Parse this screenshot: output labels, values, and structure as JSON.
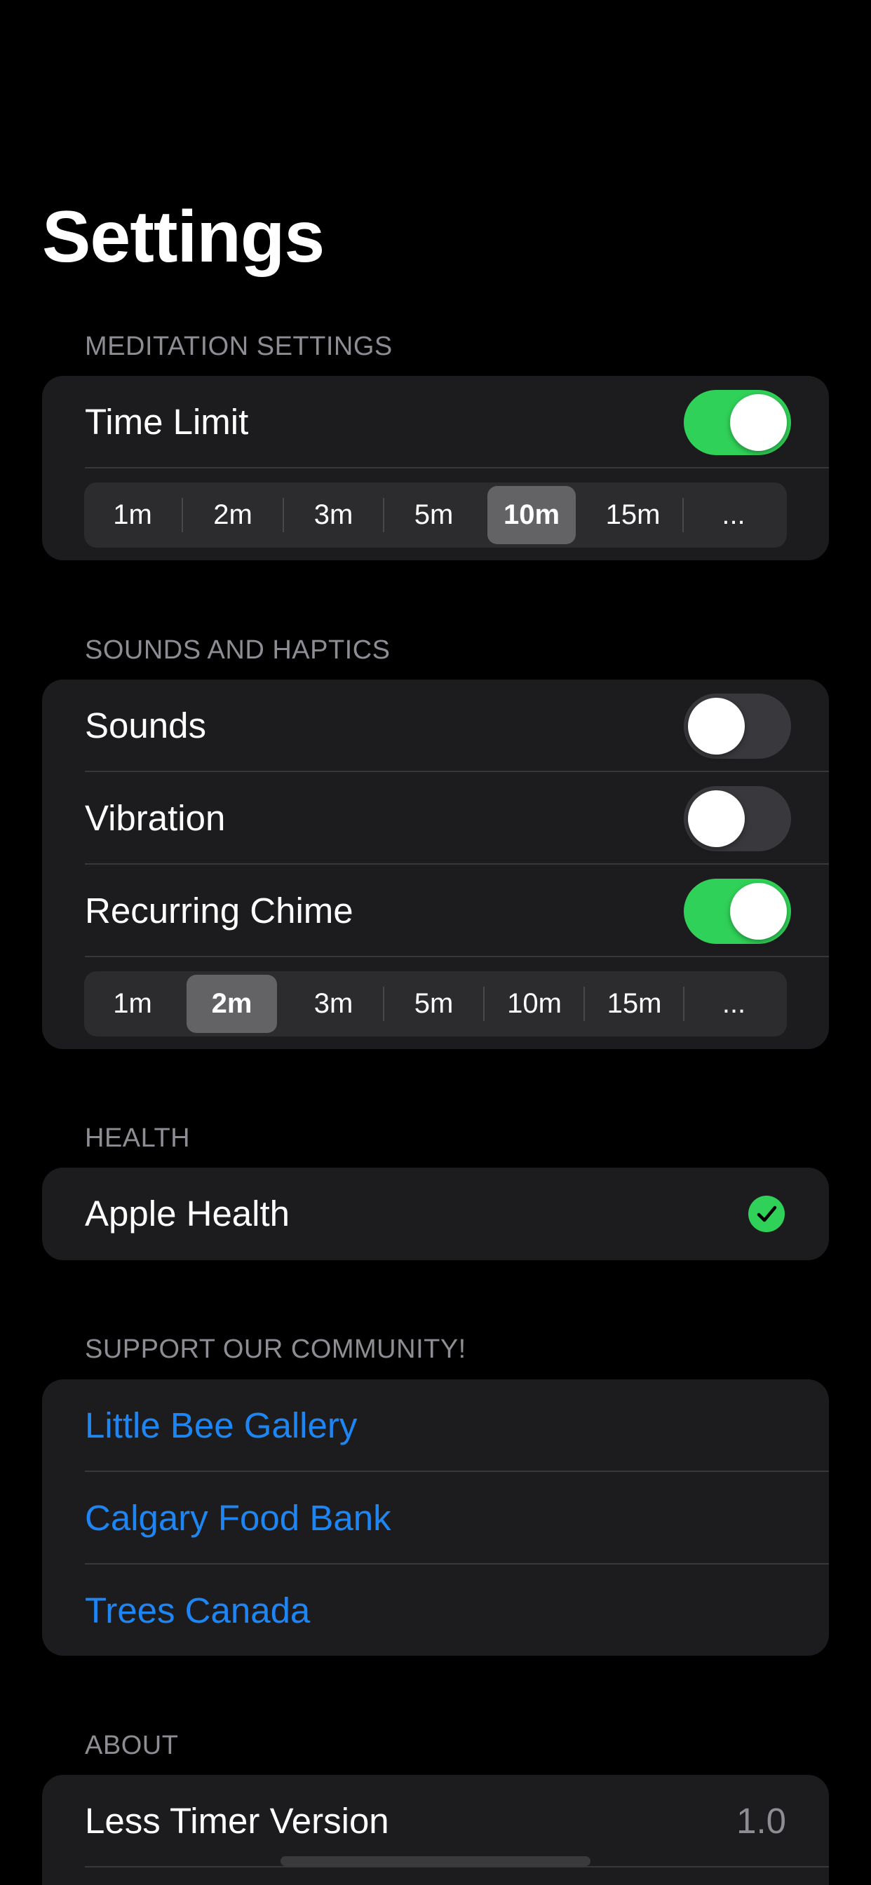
{
  "page": {
    "title": "Settings"
  },
  "meditation": {
    "header": "MEDITATION SETTINGS",
    "time_limit": {
      "label": "Time Limit",
      "enabled": true
    },
    "durations": [
      "1m",
      "2m",
      "3m",
      "5m",
      "10m",
      "15m",
      "..."
    ],
    "selected": "10m"
  },
  "sounds": {
    "header": "SOUNDS AND HAPTICS",
    "sounds": {
      "label": "Sounds",
      "enabled": false
    },
    "vibration": {
      "label": "Vibration",
      "enabled": false
    },
    "chime": {
      "label": "Recurring Chime",
      "enabled": true
    },
    "durations": [
      "1m",
      "2m",
      "3m",
      "5m",
      "10m",
      "15m",
      "..."
    ],
    "selected": "2m"
  },
  "health": {
    "header": "HEALTH",
    "apple_health": {
      "label": "Apple Health",
      "checked": true,
      "icon": "checkmark-circle-icon"
    }
  },
  "community": {
    "header": "SUPPORT OUR COMMUNITY!",
    "links": [
      "Little Bee Gallery",
      "Calgary Food Bank",
      "Trees Canada"
    ]
  },
  "about": {
    "header": "ABOUT",
    "version": {
      "label": "Less Timer Version",
      "value": "1.0"
    }
  },
  "colors": {
    "background": "#000000",
    "card": "#1c1c1e",
    "toggle_on": "#30d158",
    "toggle_off": "#39393d",
    "link": "#1e86f4",
    "secondary_text": "#8d8d93"
  }
}
